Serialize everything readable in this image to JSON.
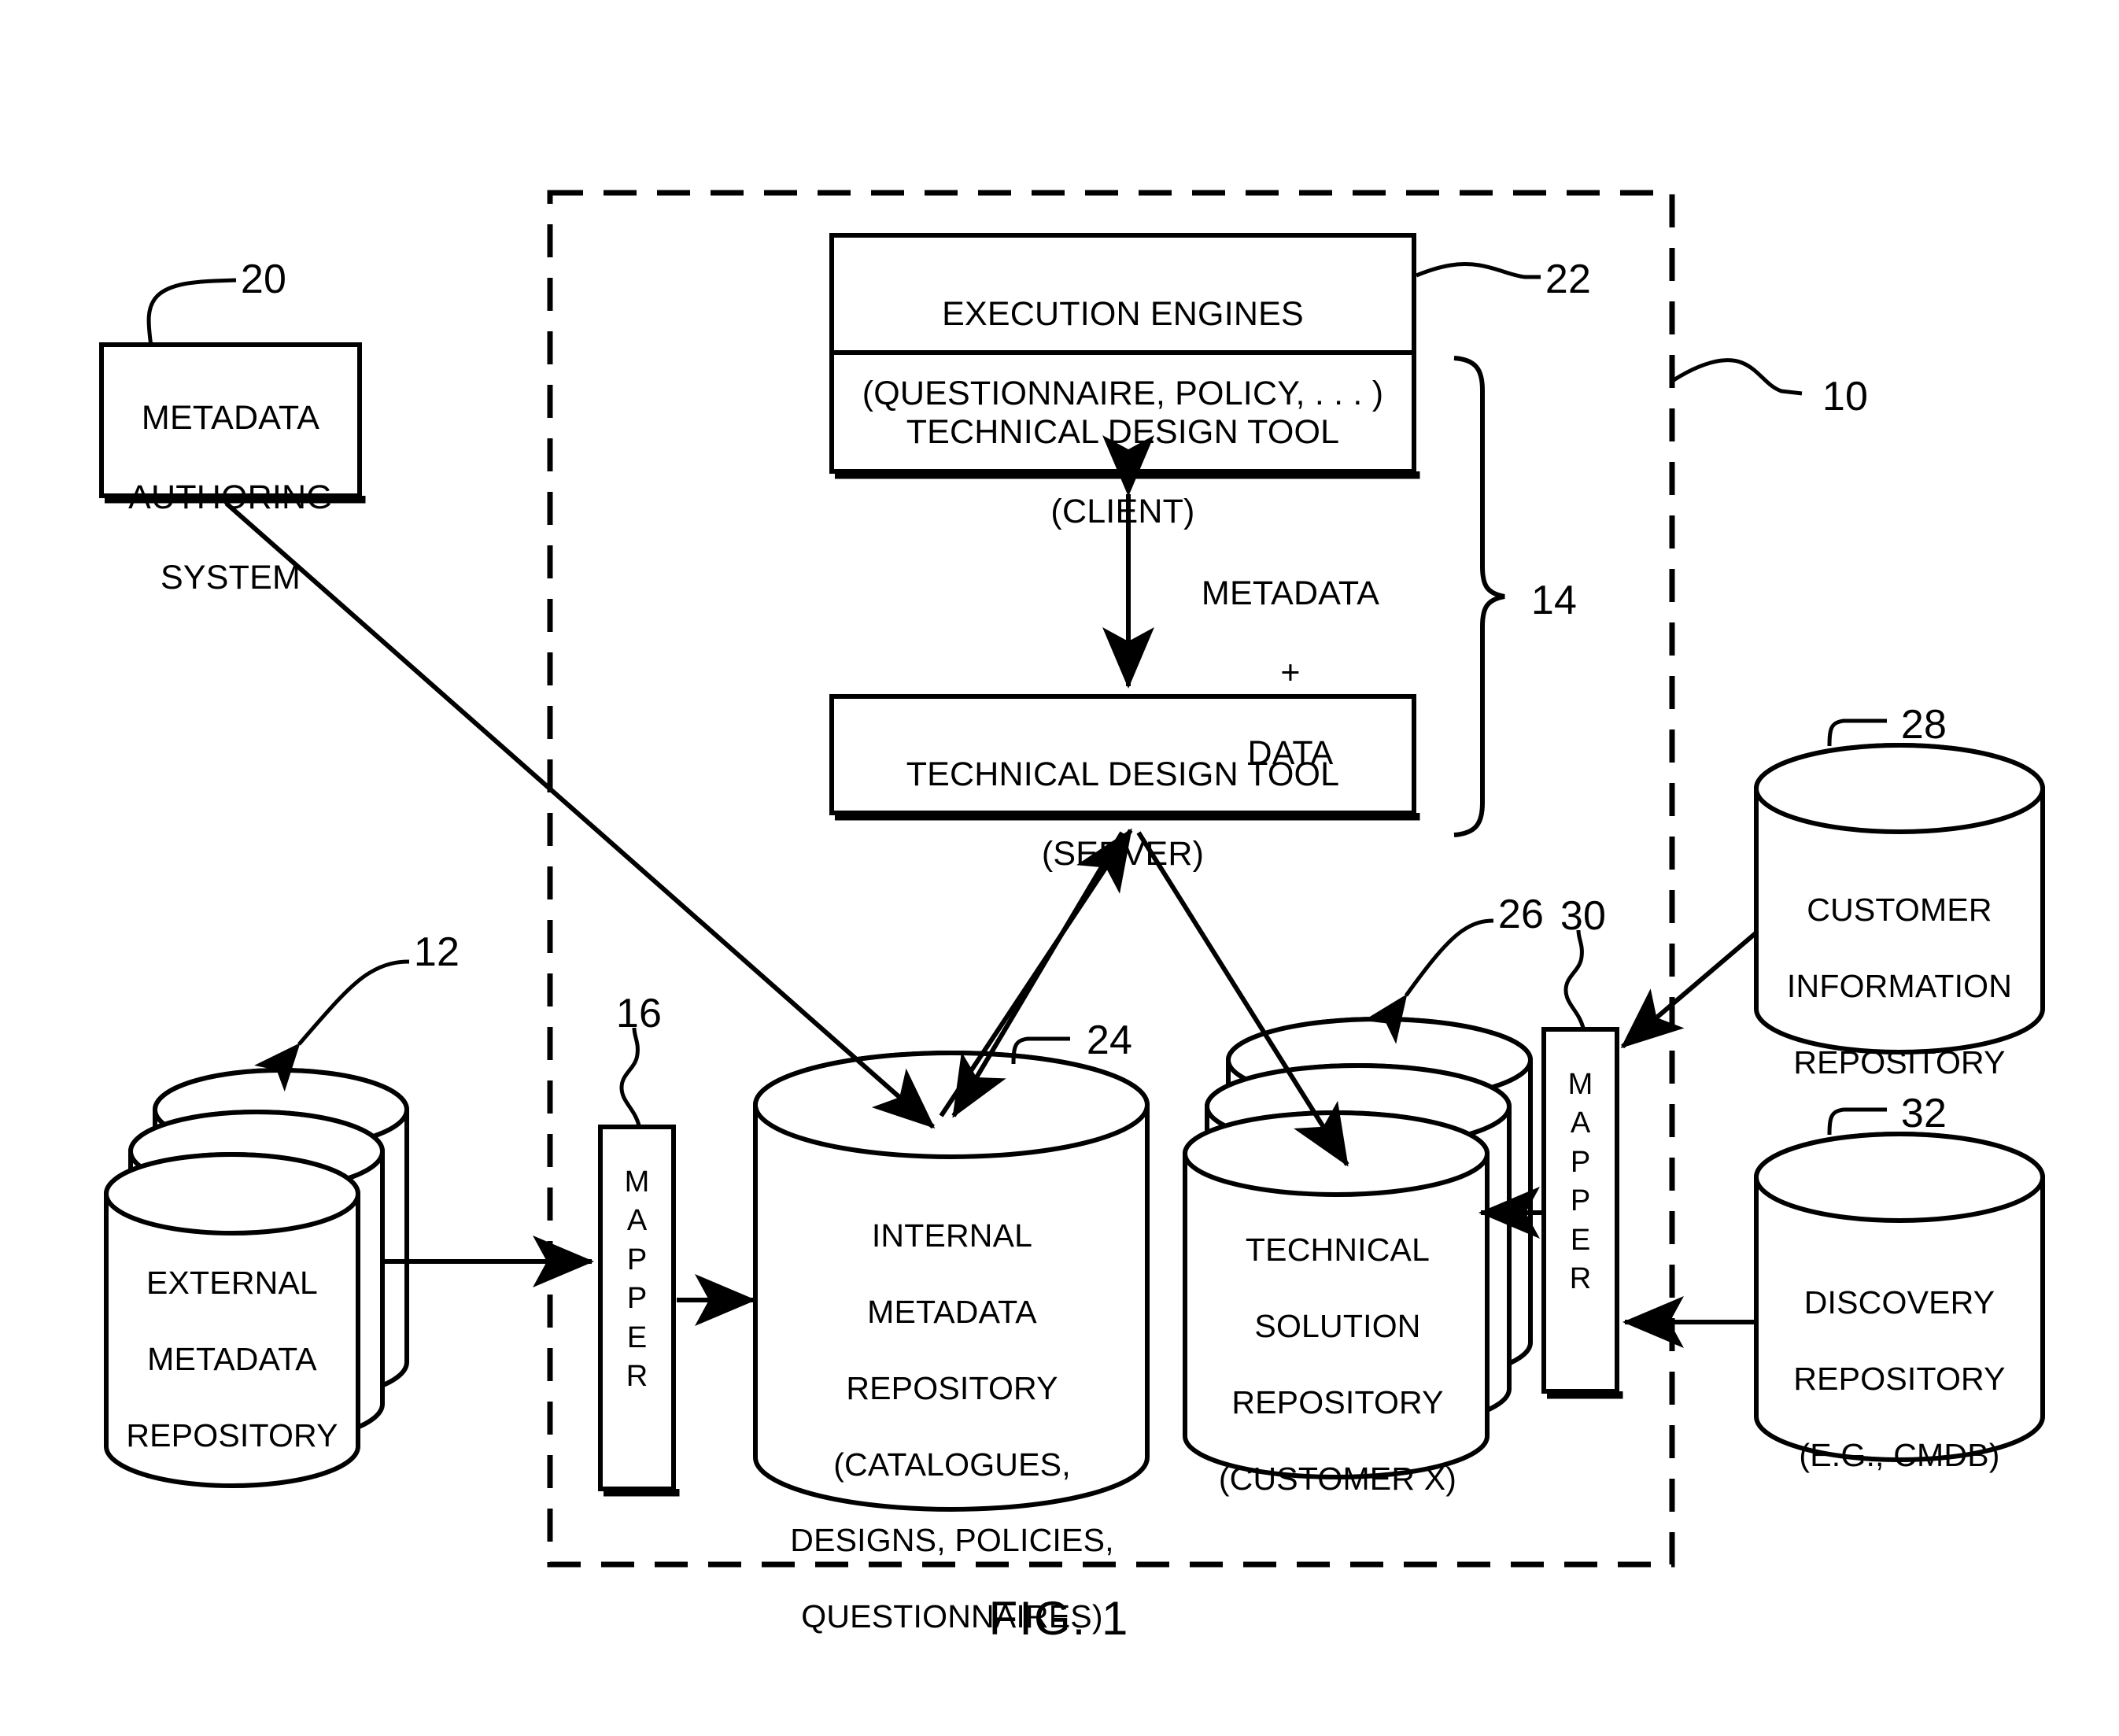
{
  "figure": {
    "caption": "FIG. 1",
    "system_ref": "10",
    "boundary_style": "dashed"
  },
  "boxes": {
    "metadata_authoring_system": {
      "line1": "METADATA",
      "line2": "AUTHORING",
      "line3": "SYSTEM",
      "ref": "20"
    },
    "execution_engines": {
      "line1": "EXECUTION ENGINES",
      "line2": "(QUESTIONNAIRE, POLICY, . . . )",
      "ref": "22"
    },
    "technical_design_tool_client": {
      "line1": "TECHNICAL DESIGN TOOL",
      "line2": "(CLIENT)"
    },
    "technical_design_tool_server": {
      "line1": "TECHNICAL DESIGN TOOL",
      "line2": "(SERVER)"
    },
    "design_tool_group": {
      "ref": "14"
    }
  },
  "mappers": {
    "mapper_left": {
      "label": "M\nA\nP\nP\nE\nR",
      "ref": "16"
    },
    "mapper_right": {
      "label": "M\nA\nP\nP\nE\nR",
      "ref": "30"
    }
  },
  "cylinders": {
    "external_metadata_repository": {
      "line1": "EXTERNAL",
      "line2": "METADATA",
      "line3": "REPOSITORY",
      "ref": "12"
    },
    "internal_metadata_repository": {
      "line1": "INTERNAL",
      "line2": "METADATA",
      "line3": "REPOSITORY",
      "line4": "(CATALOGUES,",
      "line5": "DESIGNS, POLICIES,",
      "line6": "QUESTIONNAIRES)",
      "ref": "24"
    },
    "technical_solution_repository": {
      "line1": "TECHNICAL",
      "line2": "SOLUTION",
      "line3": "REPOSITORY",
      "line4": "(CUSTOMER X)",
      "ref": "26"
    },
    "customer_information_repository": {
      "line1": "CUSTOMER",
      "line2": "INFORMATION",
      "line3": "REPOSITORY",
      "ref": "28"
    },
    "discovery_repository": {
      "line1": "DISCOVERY",
      "line2": "REPOSITORY",
      "line3": "(E.G., CMDB)",
      "ref": "32"
    }
  },
  "flows": {
    "metadata_plus_data": {
      "line1": "METADATA",
      "line2": "+",
      "line3": "DATA"
    }
  },
  "colors": {
    "ink": "#000000",
    "paper": "#ffffff"
  }
}
